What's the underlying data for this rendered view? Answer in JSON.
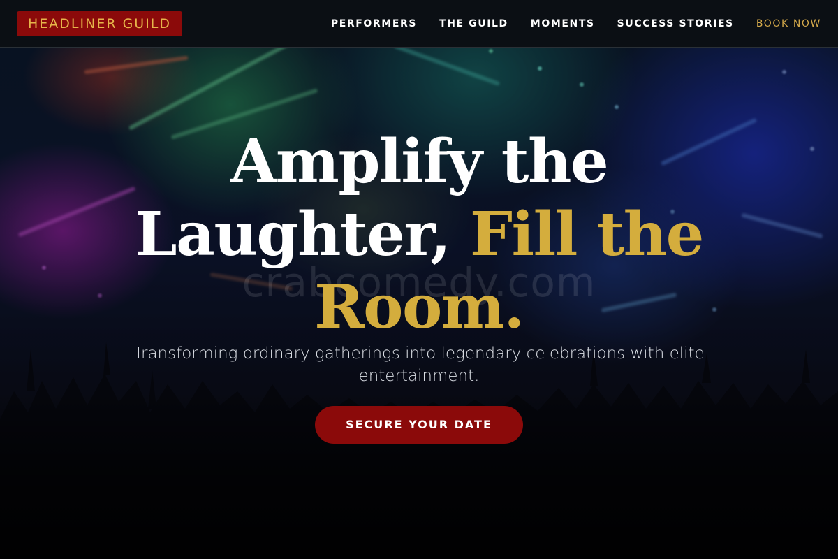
{
  "navbar": {
    "logo": "HEADLINER GUILD",
    "links": [
      {
        "label": "PERFORMERS"
      },
      {
        "label": "THE GUILD"
      },
      {
        "label": "MOMENTS"
      },
      {
        "label": "SUCCESS STORIES"
      },
      {
        "label": "BOOK NOW"
      }
    ]
  },
  "hero": {
    "headline_white": "Amplify the Laughter,",
    "headline_gold": "Fill the Room.",
    "subtext": "Transforming ordinary gatherings into legendary celebrations with elite entertainment.",
    "cta_label": "SECURE YOUR DATE",
    "watermark": "crabcomedy.com"
  },
  "colors": {
    "accent_red": "#8b0a0a",
    "accent_gold": "#d4ad3d",
    "book_now_gold": "#d4a94b",
    "navbar_bg": "#0b0f14"
  }
}
